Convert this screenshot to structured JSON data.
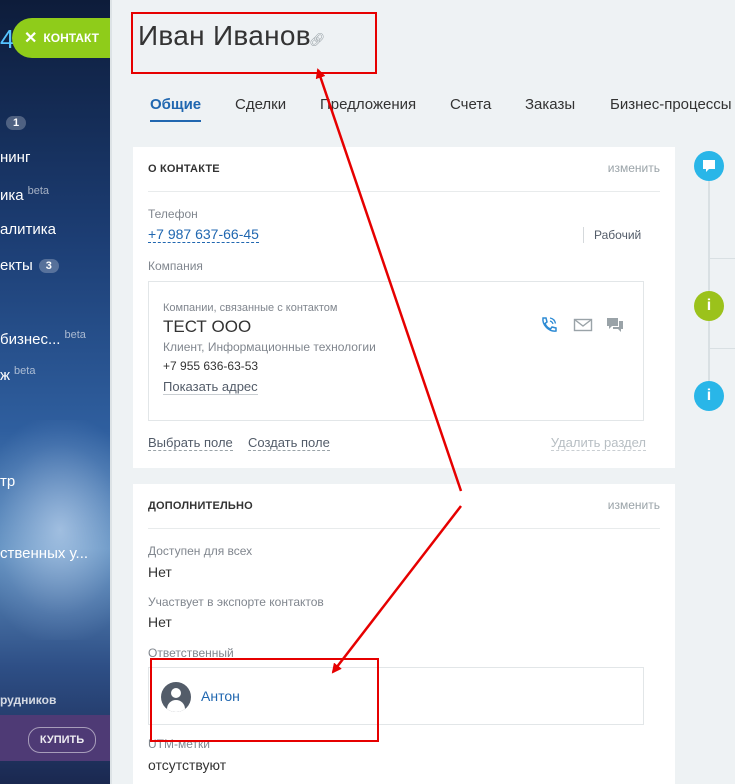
{
  "sidebar": {
    "four": "4",
    "contact_button": "КОНТАКТ",
    "items": [
      {
        "label": "",
        "badge": "1"
      },
      {
        "label": "нинг",
        "badge": ""
      },
      {
        "label": "ика",
        "sup": "beta"
      },
      {
        "label": "алитика",
        "badge": ""
      },
      {
        "label": "екты",
        "badge": "3"
      },
      {
        "label": "бизнес...",
        "sup": "beta"
      },
      {
        "label": "ж",
        "sup": "beta"
      },
      {
        "label": "тр",
        "badge": ""
      },
      {
        "label": "ственных у...",
        "badge": ""
      }
    ],
    "employees_label": "рудников",
    "buy_button": "КУПИТЬ"
  },
  "contact": {
    "name": "Иван  Иванов"
  },
  "tabs": [
    "Общие",
    "Сделки",
    "Предложения",
    "Счета",
    "Заказы",
    "Бизнес-процессы"
  ],
  "about": {
    "title": "О КОНТАКТЕ",
    "edit": "изменить",
    "phone_label": "Телефон",
    "phone": "+7 987 637-66-45",
    "phone_type": "Рабочий",
    "company_label": "Компания",
    "company_caption": "Компании, связанные с контактом",
    "company_name": "ТЕСТ ООО",
    "company_type": "Клиент, Информационные технологии",
    "company_phone": "+7 955 636-63-53",
    "show_address": "Показать адрес",
    "choose_field": "Выбрать поле",
    "create_field": "Создать поле",
    "delete_section": "Удалить раздел"
  },
  "additional": {
    "title": "ДОПОЛНИТЕЛЬНО",
    "edit": "изменить",
    "available_label": "Доступен для всех",
    "available_value": "Нет",
    "export_label": "Участвует в экспорте контактов",
    "export_value": "Нет",
    "responsible_label": "Ответственный",
    "responsible_name": "Антон",
    "utm_label": "UTM-метки",
    "utm_value": "отсутствуют"
  },
  "colors": {
    "accent": "#2067b0",
    "green_button": "#8fcc1a",
    "timeline_blue": "#29b6e8",
    "timeline_green": "#9bc21b",
    "annotation_red": "#e60000"
  },
  "icons": {
    "link": "link-icon",
    "call": "phone-call-icon",
    "mail": "envelope-icon",
    "chat": "chat-icon",
    "timeline_comment": "comment-icon",
    "timeline_info": "info-icon"
  }
}
